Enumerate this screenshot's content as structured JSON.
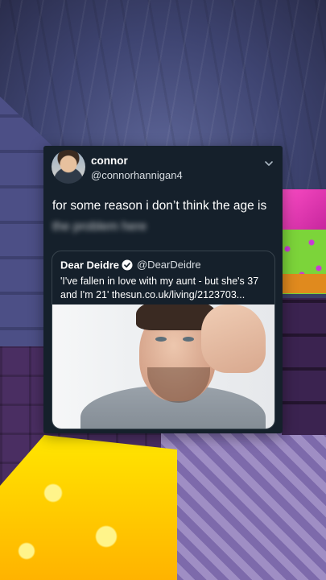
{
  "tweet": {
    "display_name": "connor",
    "handle": "@connorhannigan4",
    "text": "for some reason i don’t think the age is",
    "text_blurred": "the problem here",
    "avatar_icon": "avatar-photo",
    "menu_icon": "chevron-down-icon"
  },
  "quoted_tweet": {
    "display_name": "Dear Deidre",
    "verified_icon": "verified-badge-icon",
    "handle": "@DearDeidre",
    "text": "'I've fallen in love with my aunt - but she's 37 and I'm 21' thesun.co.uk/living/2123703...",
    "image_icon": "man-portrait-photo"
  },
  "colors": {
    "card_background": "#15202b",
    "quote_border": "#38444d",
    "verified_badge": "#ffffff",
    "text_primary": "#ffffff",
    "text_secondary": "#d9dee3"
  }
}
